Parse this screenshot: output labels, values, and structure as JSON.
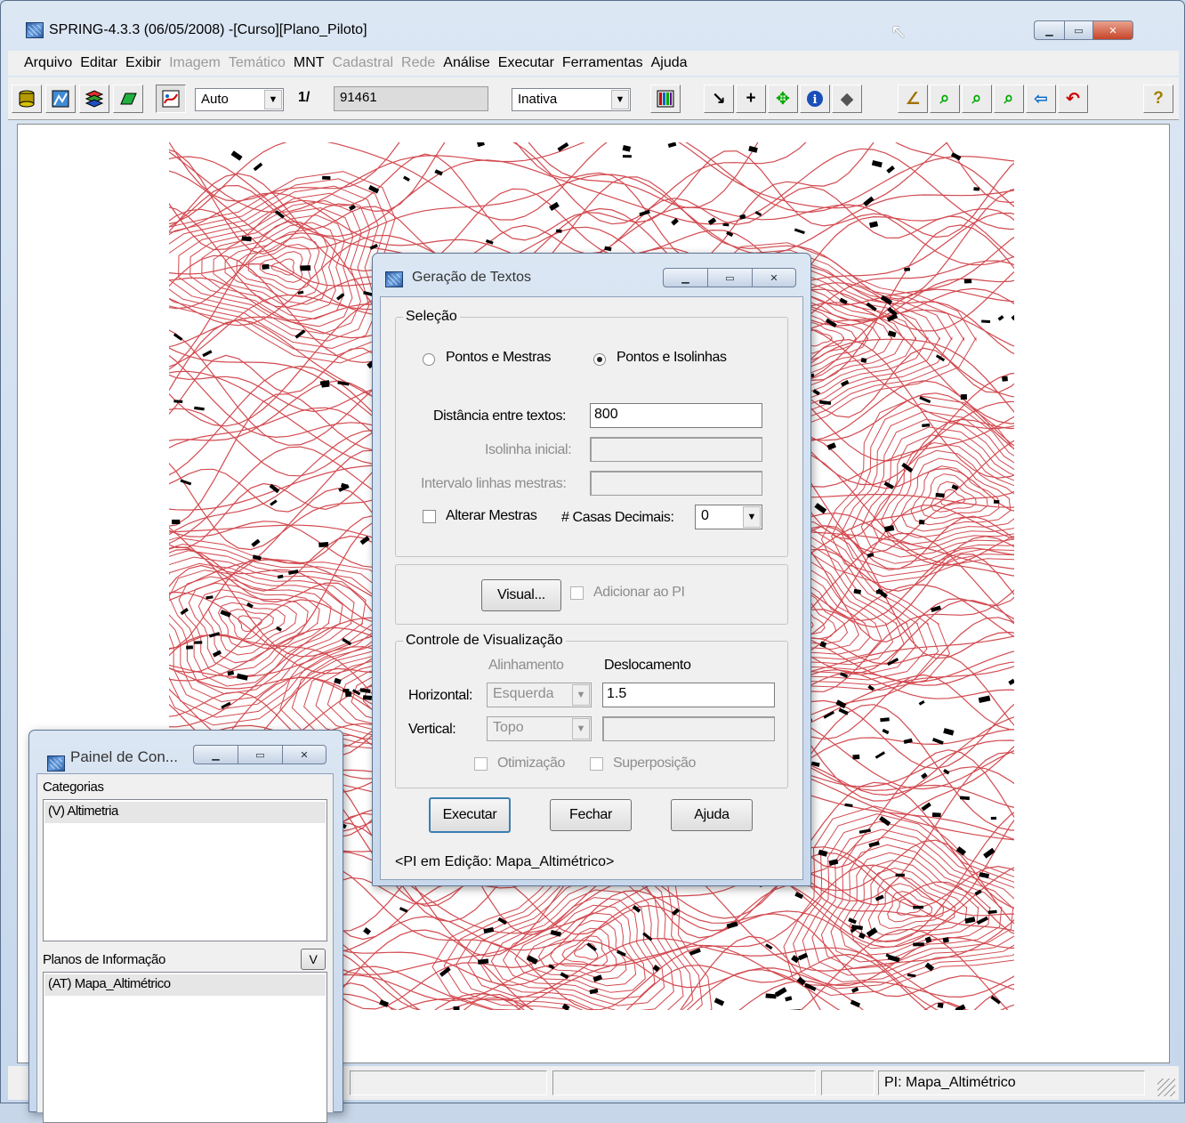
{
  "window": {
    "title": "SPRING-4.3.3 (06/05/2008) -[Curso][Plano_Piloto]",
    "min": "▁",
    "max": "▭",
    "close": "✕"
  },
  "menu": {
    "items": [
      "Arquivo",
      "Editar",
      "Exibir",
      "Imagem",
      "Temático",
      "MNT",
      "Cadastral",
      "Rede",
      "Análise",
      "Executar",
      "Ferramentas",
      "Ajuda"
    ],
    "disabled": [
      false,
      false,
      false,
      true,
      true,
      false,
      true,
      true,
      false,
      false,
      false,
      false
    ]
  },
  "toolbar": {
    "scale_mode": "Auto",
    "scale_prefix": "1/",
    "scale_value": "91461",
    "cursor_mode": "Inativa",
    "help": "?"
  },
  "status": {
    "pi": "PI: Mapa_Altimétrico"
  },
  "dialog_textos": {
    "title": "Geração de Textos",
    "selecao_label": "Seleção",
    "radio1": "Pontos e Mestras",
    "radio2": "Pontos e Isolinhas",
    "selected_radio": 2,
    "distancia_label": "Distância entre textos:",
    "distancia_value": "800",
    "isolinha_label": "Isolinha inicial:",
    "intervalo_label": "Intervalo linhas mestras:",
    "alterar_label": "Alterar Mestras",
    "casas_label": "# Casas Decimais:",
    "casas_value": "0",
    "visual_button": "Visual...",
    "adicionar_label": "Adicionar ao PI",
    "controle_label": "Controle de Visualização",
    "alinhamento_label": "Alinhamento",
    "deslocamento_label": "Deslocamento",
    "horizontal_label": "Horizontal:",
    "horizontal_align": "Esquerda",
    "horizontal_desloc": "1.5",
    "vertical_label": "Vertical:",
    "vertical_align": "Topo",
    "otimizacao_label": "Otimização",
    "superposicao_label": "Superposição",
    "executar_button": "Executar",
    "fechar_button": "Fechar",
    "ajuda_button": "Ajuda",
    "footer": "<PI em Edição: Mapa_Altimétrico>"
  },
  "painel": {
    "title": "Painel de Con...",
    "categorias_label": "Categorias",
    "categorias_item": "(V) Altimetria",
    "planos_label": "Planos de Informação",
    "planos_button": "V",
    "planos_item": "(AT) Mapa_Altimétrico"
  },
  "colors": {
    "contour": "#d24a50",
    "label_marks": "#000000"
  }
}
